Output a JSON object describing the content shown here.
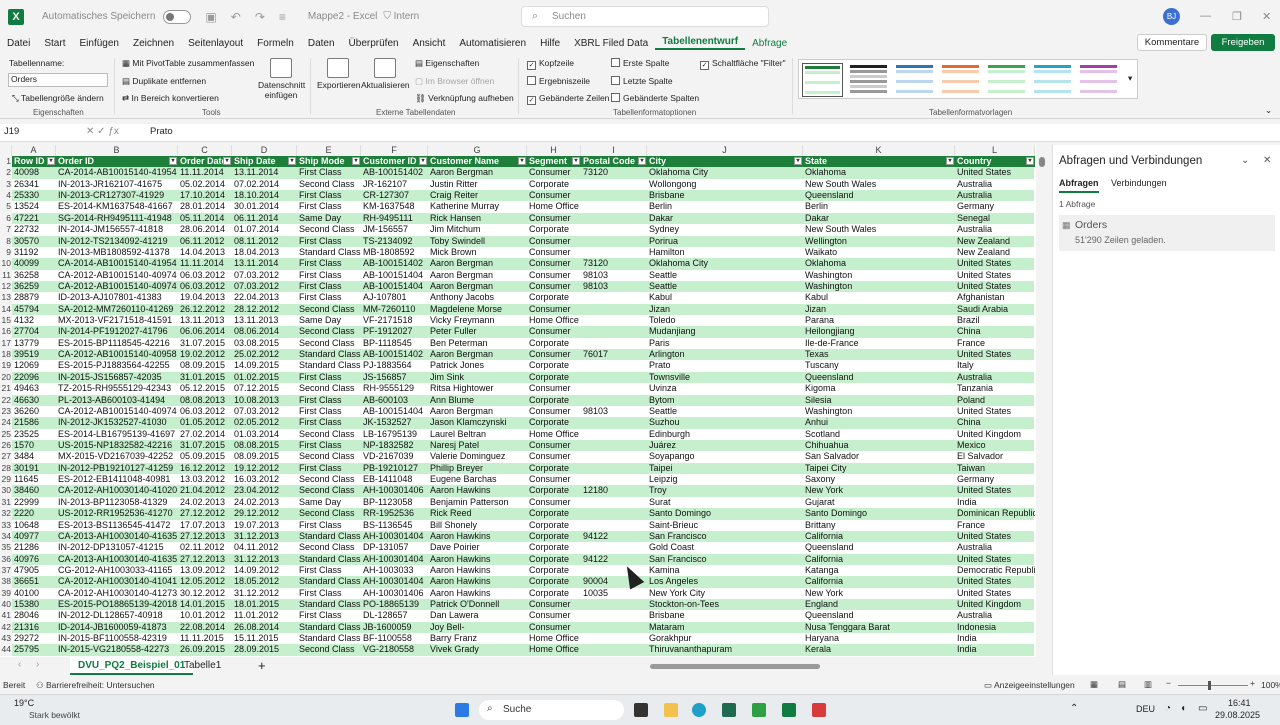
{
  "app": {
    "title": "Mappe2 - Excel",
    "label_privacy": "Intern",
    "autosave": "Automatisches Speichern",
    "search": "Suchen",
    "user": "BJ"
  },
  "menu": [
    "Datei",
    "Start",
    "Einfügen",
    "Zeichnen",
    "Seitenlayout",
    "Formeln",
    "Daten",
    "Überprüfen",
    "Ansicht",
    "Automatisieren",
    "Hilfe",
    "XBRL Filed Data",
    "Tabellenentwurf",
    "Abfrage"
  ],
  "buttons": {
    "kommentare": "Kommentare",
    "freigeben": "Freigeben"
  },
  "ribbon": {
    "tabellenname_label": "Tabellenname:",
    "tabellenname_value": "Orders",
    "resize": "Tabellengröße ändern",
    "grp_eigen": "Eigenschaften",
    "pivot": "Mit PivotTable zusammenfassen",
    "dup": "Duplikate entfernen",
    "convert": "In Bereich konvertieren",
    "grp_tools": "Tools",
    "slicer": "Datenschnitt einfügen",
    "export": "Exportieren",
    "refresh": "Aktualisieren",
    "props": "Eigenschaften",
    "browser": "Im Browser öffnen",
    "unlink": "Verknüpfung aufheben",
    "grp_ext": "Externe Tabellendaten",
    "header_row": "Kopfzeile",
    "total_row": "Ergebniszeile",
    "banded_rows": "Gebänderte Zeilen",
    "first_col": "Erste Spalte",
    "last_col": "Letzte Spalte",
    "banded_cols": "Gebänderte Spalten",
    "filter_btn": "Schaltfläche \"Filter\"",
    "grp_opts": "Tabellenformatoptionen",
    "grp_styles": "Tabellenformatvorlagen"
  },
  "formula_bar": {
    "cell": "J19",
    "content": "Prato"
  },
  "columns": [
    "A",
    "B",
    "C",
    "D",
    "E",
    "F",
    "G",
    "H",
    "I",
    "J",
    "K",
    "L"
  ],
  "headers": [
    "Row ID",
    "Order ID",
    "Order Date",
    "Ship Date",
    "Ship Mode",
    "Customer ID",
    "Customer Name",
    "Segment",
    "Postal Code",
    "City",
    "State",
    "Country"
  ],
  "rows": [
    [
      "40098",
      "CA-2014-AB10015140-41954",
      "11.11.2014",
      "13.11.2014",
      "First Class",
      "AB-100151402",
      "Aaron Bergman",
      "Consumer",
      "73120",
      "Oklahoma City",
      "Oklahoma",
      "United States"
    ],
    [
      "26341",
      "IN-2013-JR162107-41675",
      "05.02.2014",
      "07.02.2014",
      "Second Class",
      "JR-162107",
      "Justin Ritter",
      "Corporate",
      "",
      "Wollongong",
      "New South Wales",
      "Australia"
    ],
    [
      "25330",
      "IN-2013-CR127307-41929",
      "17.10.2014",
      "18.10.2014",
      "First Class",
      "CR-127307",
      "Craig Reiter",
      "Consumer",
      "",
      "Brisbane",
      "Queensland",
      "Australia"
    ],
    [
      "13524",
      "ES-2014-KM1637548-41667",
      "28.01.2014",
      "30.01.2014",
      "First Class",
      "KM-1637548",
      "Katherine Murray",
      "Home Office",
      "",
      "Berlin",
      "Berlin",
      "Germany"
    ],
    [
      "47221",
      "SG-2014-RH9495111-41948",
      "05.11.2014",
      "06.11.2014",
      "Same Day",
      "RH-9495111",
      "Rick Hansen",
      "Consumer",
      "",
      "Dakar",
      "Dakar",
      "Senegal"
    ],
    [
      "22732",
      "IN-2014-JM156557-41818",
      "28.06.2014",
      "01.07.2014",
      "Second Class",
      "JM-156557",
      "Jim Mitchum",
      "Corporate",
      "",
      "Sydney",
      "New South Wales",
      "Australia"
    ],
    [
      "30570",
      "IN-2012-TS2134092-41219",
      "06.11.2012",
      "08.11.2012",
      "First Class",
      "TS-2134092",
      "Toby Swindell",
      "Consumer",
      "",
      "Porirua",
      "Wellington",
      "New Zealand"
    ],
    [
      "31192",
      "IN-2013-MB1808592-41378",
      "14.04.2013",
      "18.04.2013",
      "Standard Class",
      "MB-1808592",
      "Mick Brown",
      "Consumer",
      "",
      "Hamilton",
      "Waikato",
      "New Zealand"
    ],
    [
      "40099",
      "CA-2014-AB10015140-41954",
      "11.11.2014",
      "13.11.2014",
      "First Class",
      "AB-100151402",
      "Aaron Bergman",
      "Consumer",
      "73120",
      "Oklahoma City",
      "Oklahoma",
      "United States"
    ],
    [
      "36258",
      "CA-2012-AB10015140-40974",
      "06.03.2012",
      "07.03.2012",
      "First Class",
      "AB-100151404",
      "Aaron Bergman",
      "Consumer",
      "98103",
      "Seattle",
      "Washington",
      "United States"
    ],
    [
      "36259",
      "CA-2012-AB10015140-40974",
      "06.03.2012",
      "07.03.2012",
      "First Class",
      "AB-100151404",
      "Aaron Bergman",
      "Consumer",
      "98103",
      "Seattle",
      "Washington",
      "United States"
    ],
    [
      "28879",
      "ID-2013-AJ107801-41383",
      "19.04.2013",
      "22.04.2013",
      "First Class",
      "AJ-107801",
      "Anthony Jacobs",
      "Corporate",
      "",
      "Kabul",
      "Kabul",
      "Afghanistan"
    ],
    [
      "45794",
      "SA-2012-MM7260110-41269",
      "26.12.2012",
      "28.12.2012",
      "Second Class",
      "MM-7260110",
      "Magdelene Morse",
      "Consumer",
      "",
      "Jizan",
      "Jizan",
      "Saudi Arabia"
    ],
    [
      "4132",
      "MX-2013-VF2171518-41591",
      "13.11.2013",
      "13.11.2013",
      "Same Day",
      "VF-2171518",
      "Vicky Freymann",
      "Home Office",
      "",
      "Toledo",
      "Parana",
      "Brazil"
    ],
    [
      "27704",
      "IN-2014-PF1912027-41796",
      "06.06.2014",
      "08.06.2014",
      "Second Class",
      "PF-1912027",
      "Peter Fuller",
      "Consumer",
      "",
      "Mudanjiang",
      "Heilongjiang",
      "China"
    ],
    [
      "13779",
      "ES-2015-BP1118545-42216",
      "31.07.2015",
      "03.08.2015",
      "Second Class",
      "BP-1118545",
      "Ben Peterman",
      "Corporate",
      "",
      "Paris",
      "Ile-de-France",
      "France"
    ],
    [
      "39519",
      "CA-2012-AB10015140-40958",
      "19.02.2012",
      "25.02.2012",
      "Standard Class",
      "AB-100151402",
      "Aaron Bergman",
      "Consumer",
      "76017",
      "Arlington",
      "Texas",
      "United States"
    ],
    [
      "12069",
      "ES-2015-PJ1883564-42255",
      "08.09.2015",
      "14.09.2015",
      "Standard Class",
      "PJ-1883564",
      "Patrick Jones",
      "Corporate",
      "",
      "Prato",
      "Tuscany",
      "Italy"
    ],
    [
      "22096",
      "IN-2015-JS156857-42035",
      "31.01.2015",
      "01.02.2015",
      "First Class",
      "JS-156857",
      "Jim Sink",
      "Corporate",
      "",
      "Townsville",
      "Queensland",
      "Australia"
    ],
    [
      "49463",
      "TZ-2015-RH9555129-42343",
      "05.12.2015",
      "07.12.2015",
      "Second Class",
      "RH-9555129",
      "Ritsa Hightower",
      "Consumer",
      "",
      "Uvinza",
      "Kigoma",
      "Tanzania"
    ],
    [
      "46630",
      "PL-2013-AB600103-41494",
      "08.08.2013",
      "10.08.2013",
      "First Class",
      "AB-600103",
      "Ann Blume",
      "Corporate",
      "",
      "Bytom",
      "Silesia",
      "Poland"
    ],
    [
      "36260",
      "CA-2012-AB10015140-40974",
      "06.03.2012",
      "07.03.2012",
      "First Class",
      "AB-100151404",
      "Aaron Bergman",
      "Consumer",
      "98103",
      "Seattle",
      "Washington",
      "United States"
    ],
    [
      "21586",
      "IN-2012-JK1532527-41030",
      "01.05.2012",
      "02.05.2012",
      "First Class",
      "JK-1532527",
      "Jason Klamczynski",
      "Corporate",
      "",
      "Suzhou",
      "Anhui",
      "China"
    ],
    [
      "23525",
      "ES-2014-LB16795139-41697",
      "27.02.2014",
      "01.03.2014",
      "Second Class",
      "LB-16795139",
      "Laurel Beltran",
      "Home Office",
      "",
      "Edinburgh",
      "Scotland",
      "United Kingdom"
    ],
    [
      "1570",
      "US-2015-NP1832582-42216",
      "31.07.2015",
      "08.08.2015",
      "First Class",
      "NP-1832582",
      "Naresj Patel",
      "Consumer",
      "",
      "Juárez",
      "Chihuahua",
      "Mexico"
    ],
    [
      "3484",
      "MX-2015-VD2167039-42252",
      "05.09.2015",
      "08.09.2015",
      "Second Class",
      "VD-2167039",
      "Valerie Dominguez",
      "Consumer",
      "",
      "Soyapango",
      "San Salvador",
      "El Salvador"
    ],
    [
      "30191",
      "IN-2012-PB19210127-41259",
      "16.12.2012",
      "19.12.2012",
      "First Class",
      "PB-19210127",
      "Phillip Breyer",
      "Corporate",
      "",
      "Taipei",
      "Taipei City",
      "Taiwan"
    ],
    [
      "11645",
      "ES-2012-EB1411048-40981",
      "13.03.2012",
      "16.03.2012",
      "Second Class",
      "EB-1411048",
      "Eugene Barchas",
      "Consumer",
      "",
      "Leipzig",
      "Saxony",
      "Germany"
    ],
    [
      "38460",
      "CA-2012-AH10030140-41020",
      "21.04.2012",
      "23.04.2012",
      "Second Class",
      "AH-100301406",
      "Aaron Hawkins",
      "Corporate",
      "12180",
      "Troy",
      "New York",
      "United States"
    ],
    [
      "22999",
      "IN-2013-BP1123058-41329",
      "24.02.2013",
      "24.02.2013",
      "Same Day",
      "BP-1123058",
      "Benjamin Patterson",
      "Consumer",
      "",
      "Surat",
      "Gujarat",
      "India"
    ],
    [
      "2220",
      "US-2012-RR1952536-41270",
      "27.12.2012",
      "29.12.2012",
      "Second Class",
      "RR-1952536",
      "Rick Reed",
      "Corporate",
      "",
      "Santo Domingo",
      "Santo Domingo",
      "Dominican Republic"
    ],
    [
      "10648",
      "ES-2013-BS1136545-41472",
      "17.07.2013",
      "19.07.2013",
      "First Class",
      "BS-1136545",
      "Bill Shonely",
      "Corporate",
      "",
      "Saint-Brieuc",
      "Brittany",
      "France"
    ],
    [
      "40977",
      "CA-2013-AH10030140-41635",
      "27.12.2013",
      "31.12.2013",
      "Standard Class",
      "AH-100301404",
      "Aaron Hawkins",
      "Corporate",
      "94122",
      "San Francisco",
      "California",
      "United States"
    ],
    [
      "21286",
      "IN-2012-DP131057-41215",
      "02.11.2012",
      "04.11.2012",
      "Second Class",
      "DP-131057",
      "Dave Poirier",
      "Corporate",
      "",
      "Gold Coast",
      "Queensland",
      "Australia"
    ],
    [
      "40976",
      "CA-2013-AH10030140-41635",
      "27.12.2013",
      "31.12.2013",
      "Standard Class",
      "AH-100301404",
      "Aaron Hawkins",
      "Corporate",
      "94122",
      "San Francisco",
      "California",
      "United States"
    ],
    [
      "47905",
      "CG-2012-AH1003033-41165",
      "13.09.2012",
      "14.09.2012",
      "First Class",
      "AH-1003033",
      "Aaron Hawkins",
      "Corporate",
      "",
      "Kamina",
      "Katanga",
      "Democratic Republic"
    ],
    [
      "36651",
      "CA-2012-AH10030140-41041",
      "12.05.2012",
      "18.05.2012",
      "Standard Class",
      "AH-100301404",
      "Aaron Hawkins",
      "Corporate",
      "90004",
      "Los Angeles",
      "California",
      "United States"
    ],
    [
      "40100",
      "CA-2012-AH10030140-41273",
      "30.12.2012",
      "31.12.2012",
      "First Class",
      "AH-100301406",
      "Aaron Hawkins",
      "Corporate",
      "10035",
      "New York City",
      "New York",
      "United States"
    ],
    [
      "15380",
      "ES-2015-PO18865139-42018",
      "14.01.2015",
      "18.01.2015",
      "Standard Class",
      "PO-18865139",
      "Patrick O'Donnell",
      "Consumer",
      "",
      "Stockton-on-Tees",
      "England",
      "United Kingdom"
    ],
    [
      "28046",
      "IN-2012-DL128657-40918",
      "10.01.2012",
      "11.01.2012",
      "First Class",
      "DL-128657",
      "Dan Lawera",
      "Consumer",
      "",
      "Brisbane",
      "Queensland",
      "Australia"
    ],
    [
      "21316",
      "ID-2014-JB1600059-41873",
      "22.08.2014",
      "26.08.2014",
      "Standard Class",
      "JB-1600059",
      "Joy Bell-",
      "Consumer",
      "",
      "Mataram",
      "Nusa Tenggara Barat",
      "Indonesia"
    ],
    [
      "29272",
      "IN-2015-BF1100558-42319",
      "11.11.2015",
      "15.11.2015",
      "Standard Class",
      "BF-1100558",
      "Barry Franz",
      "Home Office",
      "",
      "Gorakhpur",
      "Haryana",
      "India"
    ],
    [
      "25795",
      "IN-2015-VG2180558-42273",
      "26.09.2015",
      "28.09.2015",
      "Second Class",
      "VG-2180558",
      "Vivek Grady",
      "Home Office",
      "",
      "Thiruvananthapuram",
      "Kerala",
      "India"
    ]
  ],
  "panel": {
    "title": "Abfragen und Verbindungen",
    "tab1": "Abfragen",
    "tab2": "Verbindungen",
    "count": "1 Abfrage",
    "query_name": "Orders",
    "query_info": "51'290 Zeilen geladen."
  },
  "sheets": {
    "active": "DVU_PQ2_Beispiel_01",
    "other": "Tabelle1",
    "add": "+"
  },
  "status": {
    "ready": "Bereit",
    "access": "Barrierefreiheit: Untersuchen",
    "display": "Anzeigeeinstellungen",
    "zoom": "100%"
  },
  "taskbar": {
    "temp": "19°C",
    "weather": "Stark bewölkt",
    "search": "Suche",
    "lang": "DEU",
    "time": "16:41",
    "date": "29.08.2025"
  },
  "colors": {
    "accent": "#107c41",
    "header": "#1e7f3b",
    "band": "#c6efce"
  }
}
